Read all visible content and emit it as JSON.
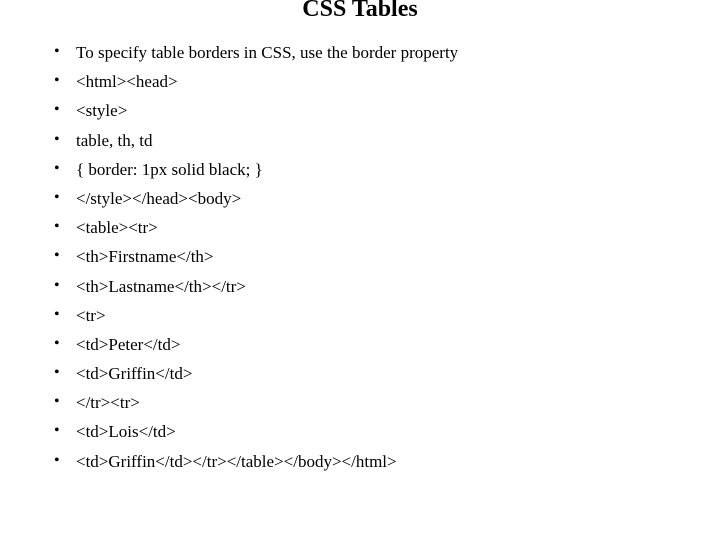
{
  "title": "CSS Tables",
  "bullets": [
    "To specify table borders in CSS, use the border property",
    "<html><head>",
    "<style>",
    "table, th, td",
    "{ border: 1px solid black; }",
    "</style></head><body>",
    "<table><tr>",
    "<th>Firstname</th>",
    "<th>Lastname</th></tr>",
    "<tr>",
    "<td>Peter</td>",
    "<td>Griffin</td>",
    "</tr><tr>",
    "<td>Lois</td>",
    "<td>Griffin</td></tr></table></body></html>"
  ]
}
